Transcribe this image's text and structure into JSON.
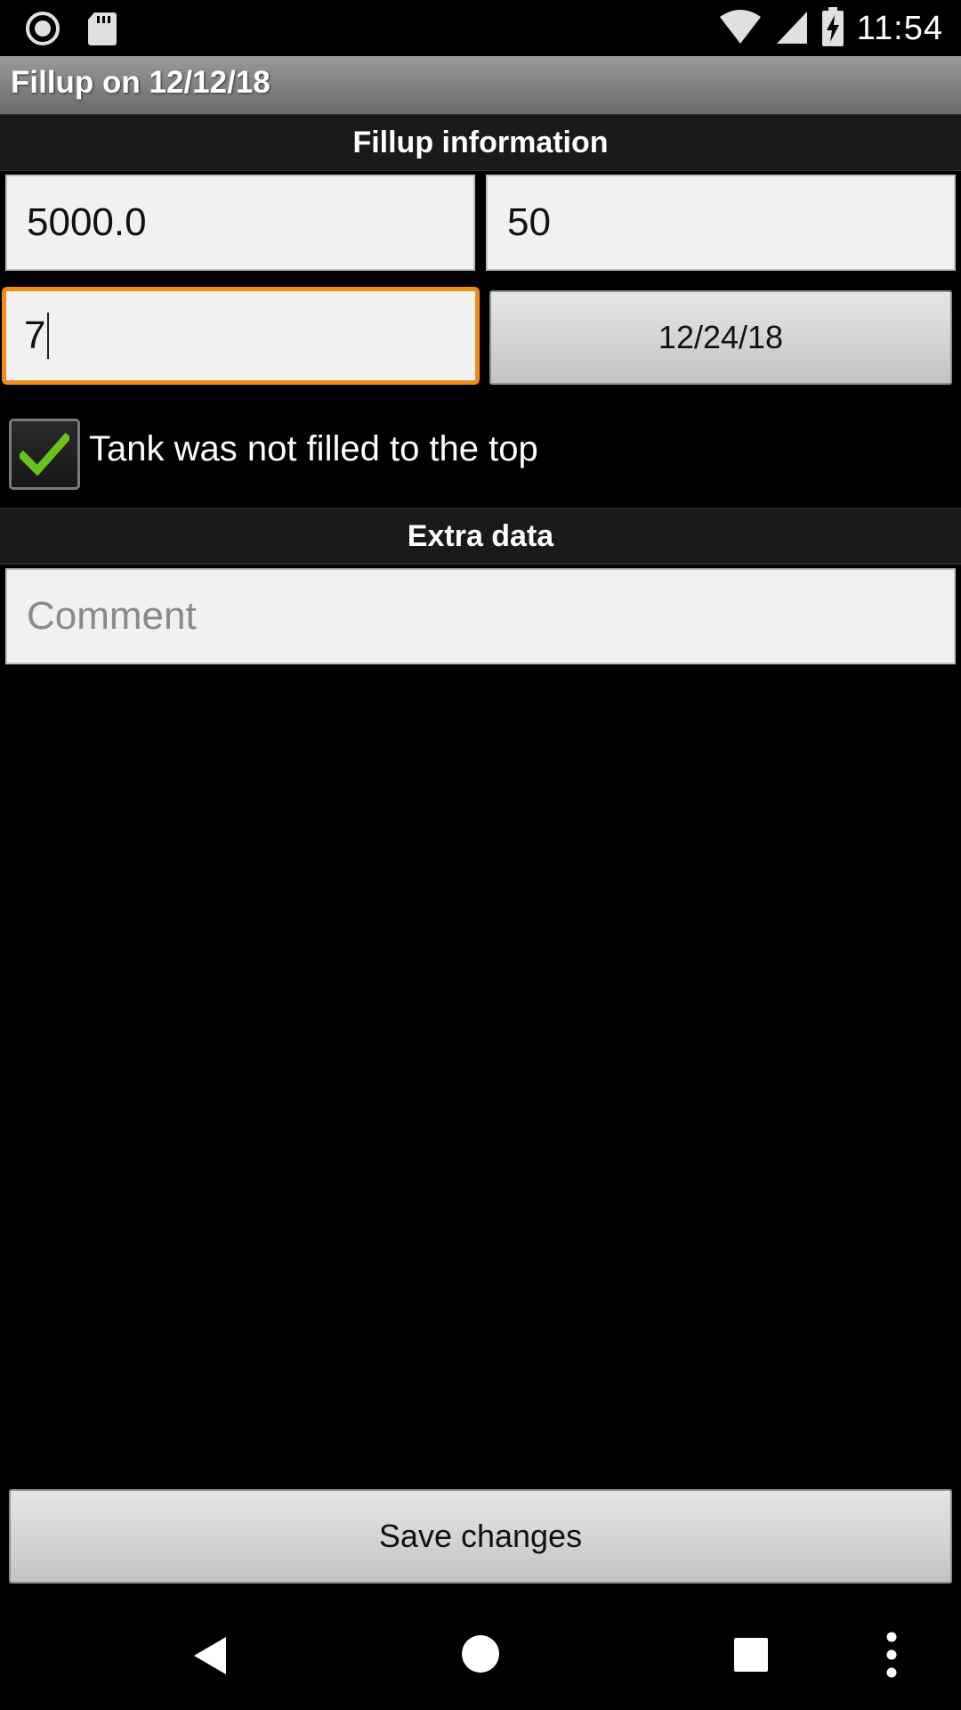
{
  "status_bar": {
    "time": "11:54",
    "left_icons": [
      "record-icon",
      "sd-card-icon"
    ],
    "right_icons": [
      "wifi-icon",
      "cell-signal-icon",
      "battery-charging-icon"
    ]
  },
  "title_bar": {
    "title": "Fillup on 12/12/18"
  },
  "fillup_section": {
    "header": "Fillup information",
    "odometer_value": "5000.0",
    "amount_value": "50",
    "price_value": "7",
    "date_button_label": "12/24/18"
  },
  "checkbox": {
    "checked": true,
    "label": "Tank was not filled to the top"
  },
  "extra_section": {
    "header": "Extra data",
    "comment_placeholder": "Comment",
    "comment_value": ""
  },
  "save_button": {
    "label": "Save changes"
  },
  "nav_bar": {
    "items": [
      "back-icon",
      "home-icon",
      "recents-icon",
      "overflow-menu-icon"
    ]
  },
  "colors": {
    "focus_border": "#f08c1a",
    "check_green": "#6cc11b",
    "background": "#000000"
  }
}
